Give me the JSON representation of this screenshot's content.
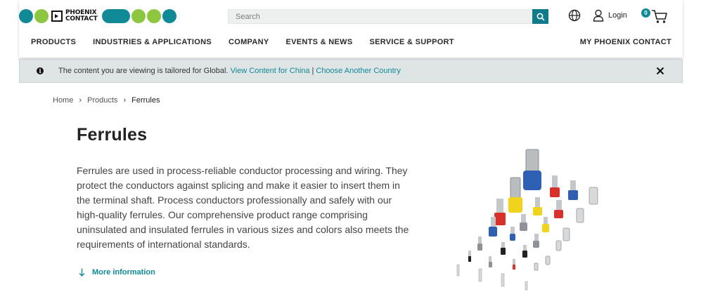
{
  "header": {
    "brand": {
      "line1": "PHOENIX",
      "line2": "CONTACT"
    },
    "colors": {
      "teal": "#0f8a96",
      "teal_dark": "#0f7b8a",
      "lime": "#8cc63f",
      "text": "#222222"
    },
    "search": {
      "placeholder": "Search"
    },
    "login_label": "Login",
    "cart_count": "0",
    "nav": [
      "PRODUCTS",
      "INDUSTRIES & APPLICATIONS",
      "COMPANY",
      "EVENTS & NEWS",
      "SERVICE & SUPPORT"
    ],
    "nav_right": "MY PHOENIX CONTACT"
  },
  "notice": {
    "text": "The content you are viewing is tailored for Global.",
    "link1": "View Content for China",
    "separator": "|",
    "link2": "Choose Another Country"
  },
  "breadcrumb": [
    "Home",
    "Products",
    "Ferrules"
  ],
  "page": {
    "title": "Ferrules",
    "description": "Ferrules are used in process-reliable conductor processing and wiring. They protect the conductors against splicing and make it easier to insert them in the terminal shaft. Process conductors professionally and safely with our high-quality ferrules. Our comprehensive product range comprising uninsulated and insulated ferrules in various sizes and colors also meets the requirements of international standards.",
    "more_label": "More information"
  },
  "icons": {
    "search": "search-icon",
    "globe": "globe-icon",
    "user": "user-icon",
    "cart": "cart-icon",
    "info": "info-icon",
    "close": "close-icon",
    "arrow": "arrow-down-icon"
  }
}
